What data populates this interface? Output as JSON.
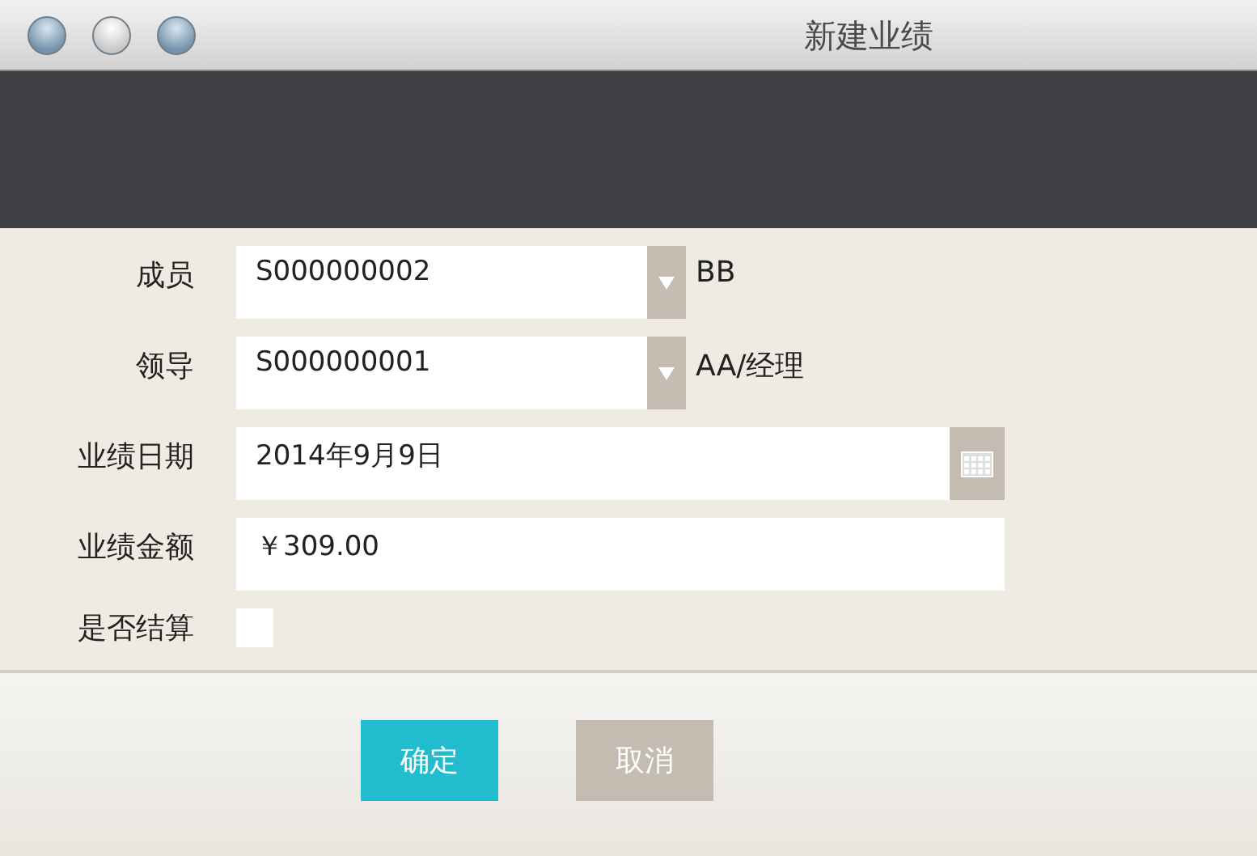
{
  "window": {
    "title": "新建业绩"
  },
  "fields": [
    {
      "kind": "select",
      "label": "成员",
      "value": "S000000002",
      "note": "BB"
    },
    {
      "kind": "select",
      "label": "领导",
      "value": "S000000001",
      "note": "AA/经理"
    },
    {
      "kind": "date",
      "label": "业绩日期",
      "value": "2014年9月9日"
    },
    {
      "kind": "text",
      "label": "业绩金额",
      "value": "￥309.00"
    },
    {
      "kind": "checkbox",
      "label": "是否结算",
      "checked": false
    }
  ],
  "buttons": [
    {
      "kind": "primary",
      "label": "确定"
    },
    {
      "kind": "secondary",
      "label": "取消"
    }
  ]
}
